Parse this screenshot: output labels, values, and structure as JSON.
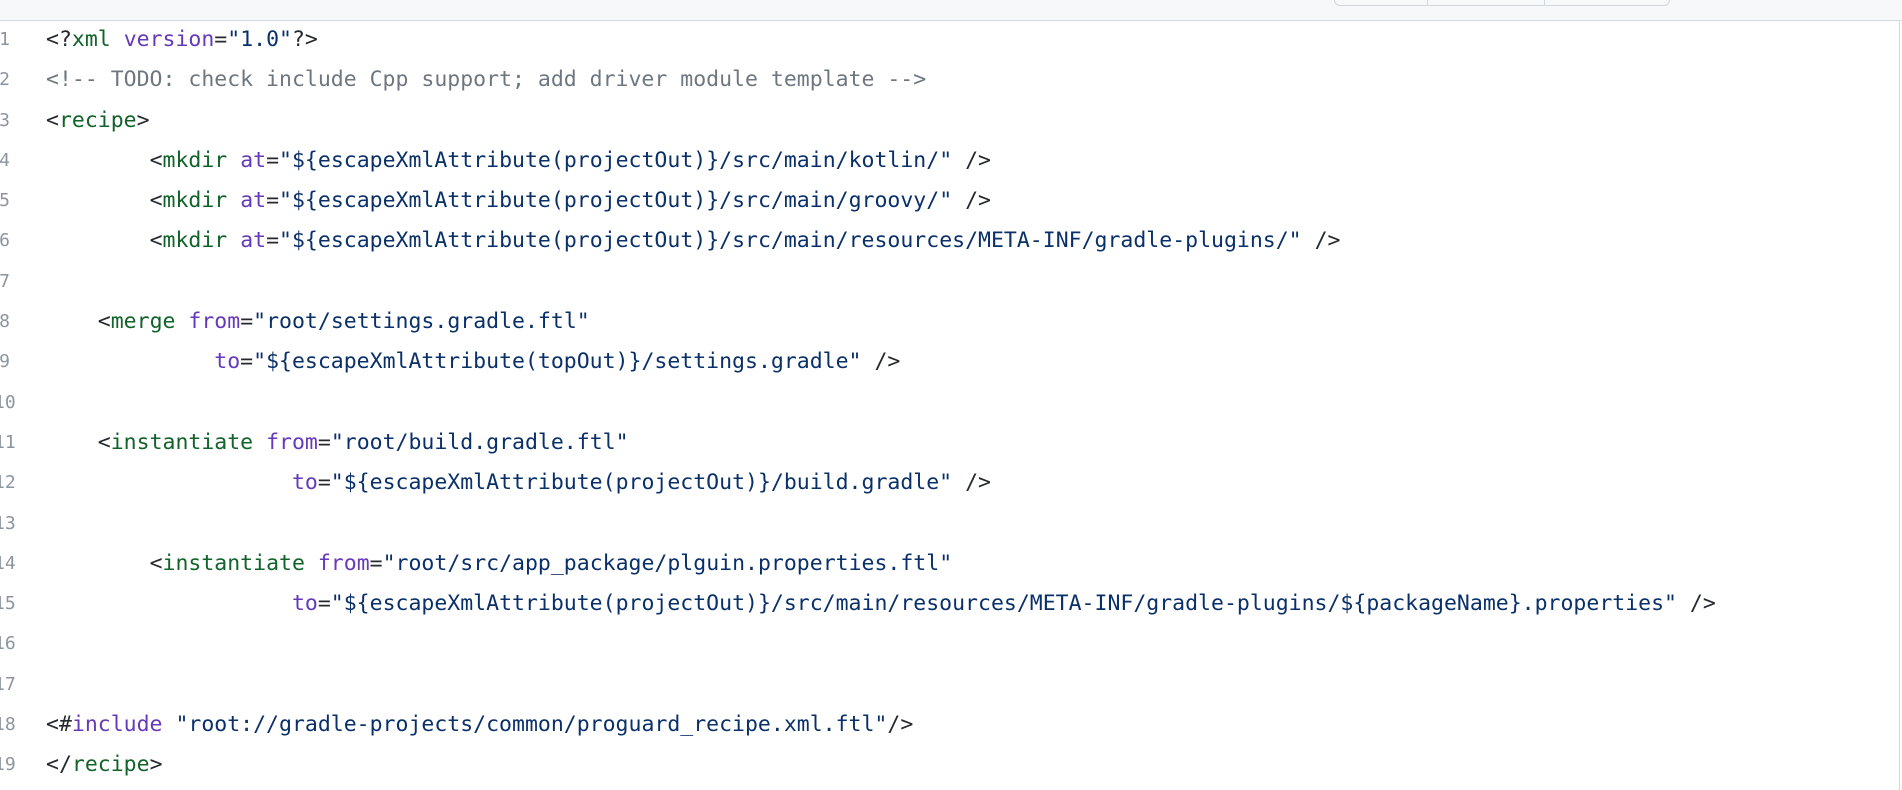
{
  "code": {
    "lines": [
      {
        "n": "1",
        "indent": "",
        "tokens": [
          {
            "t": "<?",
            "c": "punct"
          },
          {
            "t": "xml",
            "c": "tag"
          },
          {
            "t": " ",
            "c": "punct"
          },
          {
            "t": "version",
            "c": "attr"
          },
          {
            "t": "=",
            "c": "punct"
          },
          {
            "t": "\"1.0\"",
            "c": "str"
          },
          {
            "t": "?>",
            "c": "punct"
          }
        ]
      },
      {
        "n": "2",
        "indent": "",
        "tokens": [
          {
            "t": "<!-- TODO: check include Cpp support; add driver module template -->",
            "c": "comment"
          }
        ]
      },
      {
        "n": "3",
        "indent": "",
        "tokens": [
          {
            "t": "<",
            "c": "punct"
          },
          {
            "t": "recipe",
            "c": "tag"
          },
          {
            "t": ">",
            "c": "punct"
          }
        ]
      },
      {
        "n": "4",
        "indent": "        ",
        "tokens": [
          {
            "t": "<",
            "c": "punct"
          },
          {
            "t": "mkdir",
            "c": "tag"
          },
          {
            "t": " ",
            "c": "punct"
          },
          {
            "t": "at",
            "c": "attr"
          },
          {
            "t": "=",
            "c": "punct"
          },
          {
            "t": "\"${escapeXmlAttribute(projectOut)}/src/main/kotlin/\"",
            "c": "str"
          },
          {
            "t": " />",
            "c": "punct"
          }
        ]
      },
      {
        "n": "5",
        "indent": "        ",
        "tokens": [
          {
            "t": "<",
            "c": "punct"
          },
          {
            "t": "mkdir",
            "c": "tag"
          },
          {
            "t": " ",
            "c": "punct"
          },
          {
            "t": "at",
            "c": "attr"
          },
          {
            "t": "=",
            "c": "punct"
          },
          {
            "t": "\"${escapeXmlAttribute(projectOut)}/src/main/groovy/\"",
            "c": "str"
          },
          {
            "t": " />",
            "c": "punct"
          }
        ]
      },
      {
        "n": "6",
        "indent": "        ",
        "tokens": [
          {
            "t": "<",
            "c": "punct"
          },
          {
            "t": "mkdir",
            "c": "tag"
          },
          {
            "t": " ",
            "c": "punct"
          },
          {
            "t": "at",
            "c": "attr"
          },
          {
            "t": "=",
            "c": "punct"
          },
          {
            "t": "\"${escapeXmlAttribute(projectOut)}/src/main/resources/META-INF/gradle-plugins/\"",
            "c": "str"
          },
          {
            "t": " />",
            "c": "punct"
          }
        ]
      },
      {
        "n": "7",
        "indent": "",
        "tokens": []
      },
      {
        "n": "8",
        "indent": "    ",
        "tokens": [
          {
            "t": "<",
            "c": "punct"
          },
          {
            "t": "merge",
            "c": "tag"
          },
          {
            "t": " ",
            "c": "punct"
          },
          {
            "t": "from",
            "c": "attr"
          },
          {
            "t": "=",
            "c": "punct"
          },
          {
            "t": "\"root/settings.gradle.ftl\"",
            "c": "str"
          }
        ]
      },
      {
        "n": "9",
        "indent": "             ",
        "tokens": [
          {
            "t": "to",
            "c": "attr"
          },
          {
            "t": "=",
            "c": "punct"
          },
          {
            "t": "\"${escapeXmlAttribute(topOut)}/settings.gradle\"",
            "c": "str"
          },
          {
            "t": " />",
            "c": "punct"
          }
        ]
      },
      {
        "n": "10",
        "indent": "",
        "tokens": []
      },
      {
        "n": "11",
        "indent": "    ",
        "tokens": [
          {
            "t": "<",
            "c": "punct"
          },
          {
            "t": "instantiate",
            "c": "tag"
          },
          {
            "t": " ",
            "c": "punct"
          },
          {
            "t": "from",
            "c": "attr"
          },
          {
            "t": "=",
            "c": "punct"
          },
          {
            "t": "\"root/build.gradle.ftl\"",
            "c": "str"
          }
        ]
      },
      {
        "n": "12",
        "indent": "                   ",
        "tokens": [
          {
            "t": "to",
            "c": "attr"
          },
          {
            "t": "=",
            "c": "punct"
          },
          {
            "t": "\"${escapeXmlAttribute(projectOut)}/build.gradle\"",
            "c": "str"
          },
          {
            "t": " />",
            "c": "punct"
          }
        ]
      },
      {
        "n": "13",
        "indent": "",
        "tokens": []
      },
      {
        "n": "14",
        "indent": "        ",
        "tokens": [
          {
            "t": "<",
            "c": "punct"
          },
          {
            "t": "instantiate",
            "c": "tag"
          },
          {
            "t": " ",
            "c": "punct"
          },
          {
            "t": "from",
            "c": "attr"
          },
          {
            "t": "=",
            "c": "punct"
          },
          {
            "t": "\"root/src/app_package/plguin.properties.ftl\"",
            "c": "str"
          }
        ]
      },
      {
        "n": "15",
        "indent": "                   ",
        "tokens": [
          {
            "t": "to",
            "c": "attr"
          },
          {
            "t": "=",
            "c": "punct"
          },
          {
            "t": "\"${escapeXmlAttribute(projectOut)}/src/main/resources/META-INF/gradle-plugins/${packageName}.properties\"",
            "c": "str"
          },
          {
            "t": " />",
            "c": "punct"
          }
        ]
      },
      {
        "n": "16",
        "indent": "",
        "tokens": []
      },
      {
        "n": "17",
        "indent": "",
        "tokens": []
      },
      {
        "n": "18",
        "indent": "",
        "tokens": [
          {
            "t": "<#",
            "c": "punct"
          },
          {
            "t": "include",
            "c": "attr"
          },
          {
            "t": " ",
            "c": "punct"
          },
          {
            "t": "\"root://gradle-projects/common/proguard_recipe.xml.ftl\"",
            "c": "str"
          },
          {
            "t": "/>",
            "c": "punct"
          }
        ]
      },
      {
        "n": "19",
        "indent": "",
        "tokens": [
          {
            "t": "</",
            "c": "punct"
          },
          {
            "t": "recipe",
            "c": "tag"
          },
          {
            "t": ">",
            "c": "punct"
          }
        ]
      }
    ]
  }
}
